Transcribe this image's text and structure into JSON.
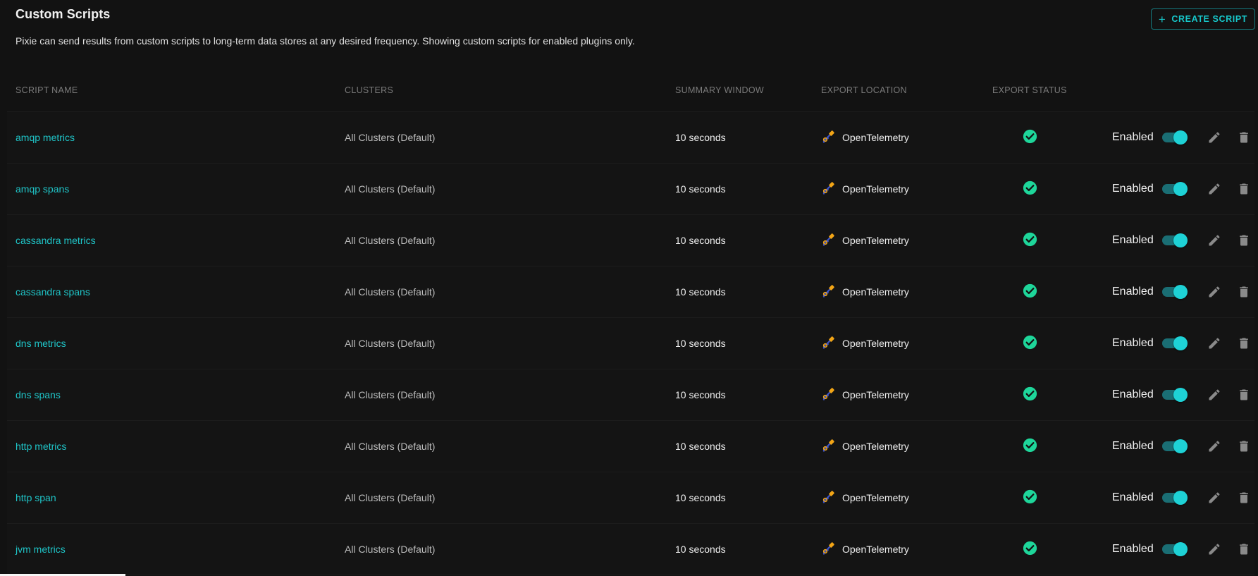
{
  "header": {
    "title": "Custom Scripts",
    "description": "Pixie can send results from custom scripts to long-term data stores at any desired frequency. Showing custom scripts for enabled plugins only.",
    "create_button": "CREATE SCRIPT"
  },
  "columns": {
    "name": "SCRIPT NAME",
    "clusters": "CLUSTERS",
    "window": "SUMMARY WINDOW",
    "export_location": "EXPORT LOCATION",
    "export_status": "EXPORT STATUS"
  },
  "rows": [
    {
      "name": "amqp metrics",
      "clusters": "All Clusters (Default)",
      "window": "10 seconds",
      "export": "OpenTelemetry",
      "status_icon": "check-circle-icon",
      "enabled_label": "Enabled",
      "enabled": true
    },
    {
      "name": "amqp spans",
      "clusters": "All Clusters (Default)",
      "window": "10 seconds",
      "export": "OpenTelemetry",
      "status_icon": "check-circle-icon",
      "enabled_label": "Enabled",
      "enabled": true
    },
    {
      "name": "cassandra metrics",
      "clusters": "All Clusters (Default)",
      "window": "10 seconds",
      "export": "OpenTelemetry",
      "status_icon": "check-circle-icon",
      "enabled_label": "Enabled",
      "enabled": true
    },
    {
      "name": "cassandra spans",
      "clusters": "All Clusters (Default)",
      "window": "10 seconds",
      "export": "OpenTelemetry",
      "status_icon": "check-circle-icon",
      "enabled_label": "Enabled",
      "enabled": true
    },
    {
      "name": "dns metrics",
      "clusters": "All Clusters (Default)",
      "window": "10 seconds",
      "export": "OpenTelemetry",
      "status_icon": "check-circle-icon",
      "enabled_label": "Enabled",
      "enabled": true
    },
    {
      "name": "dns spans",
      "clusters": "All Clusters (Default)",
      "window": "10 seconds",
      "export": "OpenTelemetry",
      "status_icon": "check-circle-icon",
      "enabled_label": "Enabled",
      "enabled": true
    },
    {
      "name": "http metrics",
      "clusters": "All Clusters (Default)",
      "window": "10 seconds",
      "export": "OpenTelemetry",
      "status_icon": "check-circle-icon",
      "enabled_label": "Enabled",
      "enabled": true
    },
    {
      "name": "http span",
      "clusters": "All Clusters (Default)",
      "window": "10 seconds",
      "export": "OpenTelemetry",
      "status_icon": "check-circle-icon",
      "enabled_label": "Enabled",
      "enabled": true
    },
    {
      "name": "jvm metrics",
      "clusters": "All Clusters (Default)",
      "window": "10 seconds",
      "export": "OpenTelemetry",
      "status_icon": "check-circle-icon",
      "enabled_label": "Enabled",
      "enabled": true
    }
  ],
  "icons": {
    "create": "plus-icon",
    "export_location": "opentelemetry-logo-icon",
    "status": "check-circle-icon",
    "edit": "pencil-icon",
    "delete": "trash-icon"
  },
  "colors": {
    "accent": "#1fc5c8",
    "status_ok": "#1ed69a",
    "toggle_track": "#1a6e74",
    "toggle_knob": "#1ed2d6",
    "background": "#121212"
  }
}
